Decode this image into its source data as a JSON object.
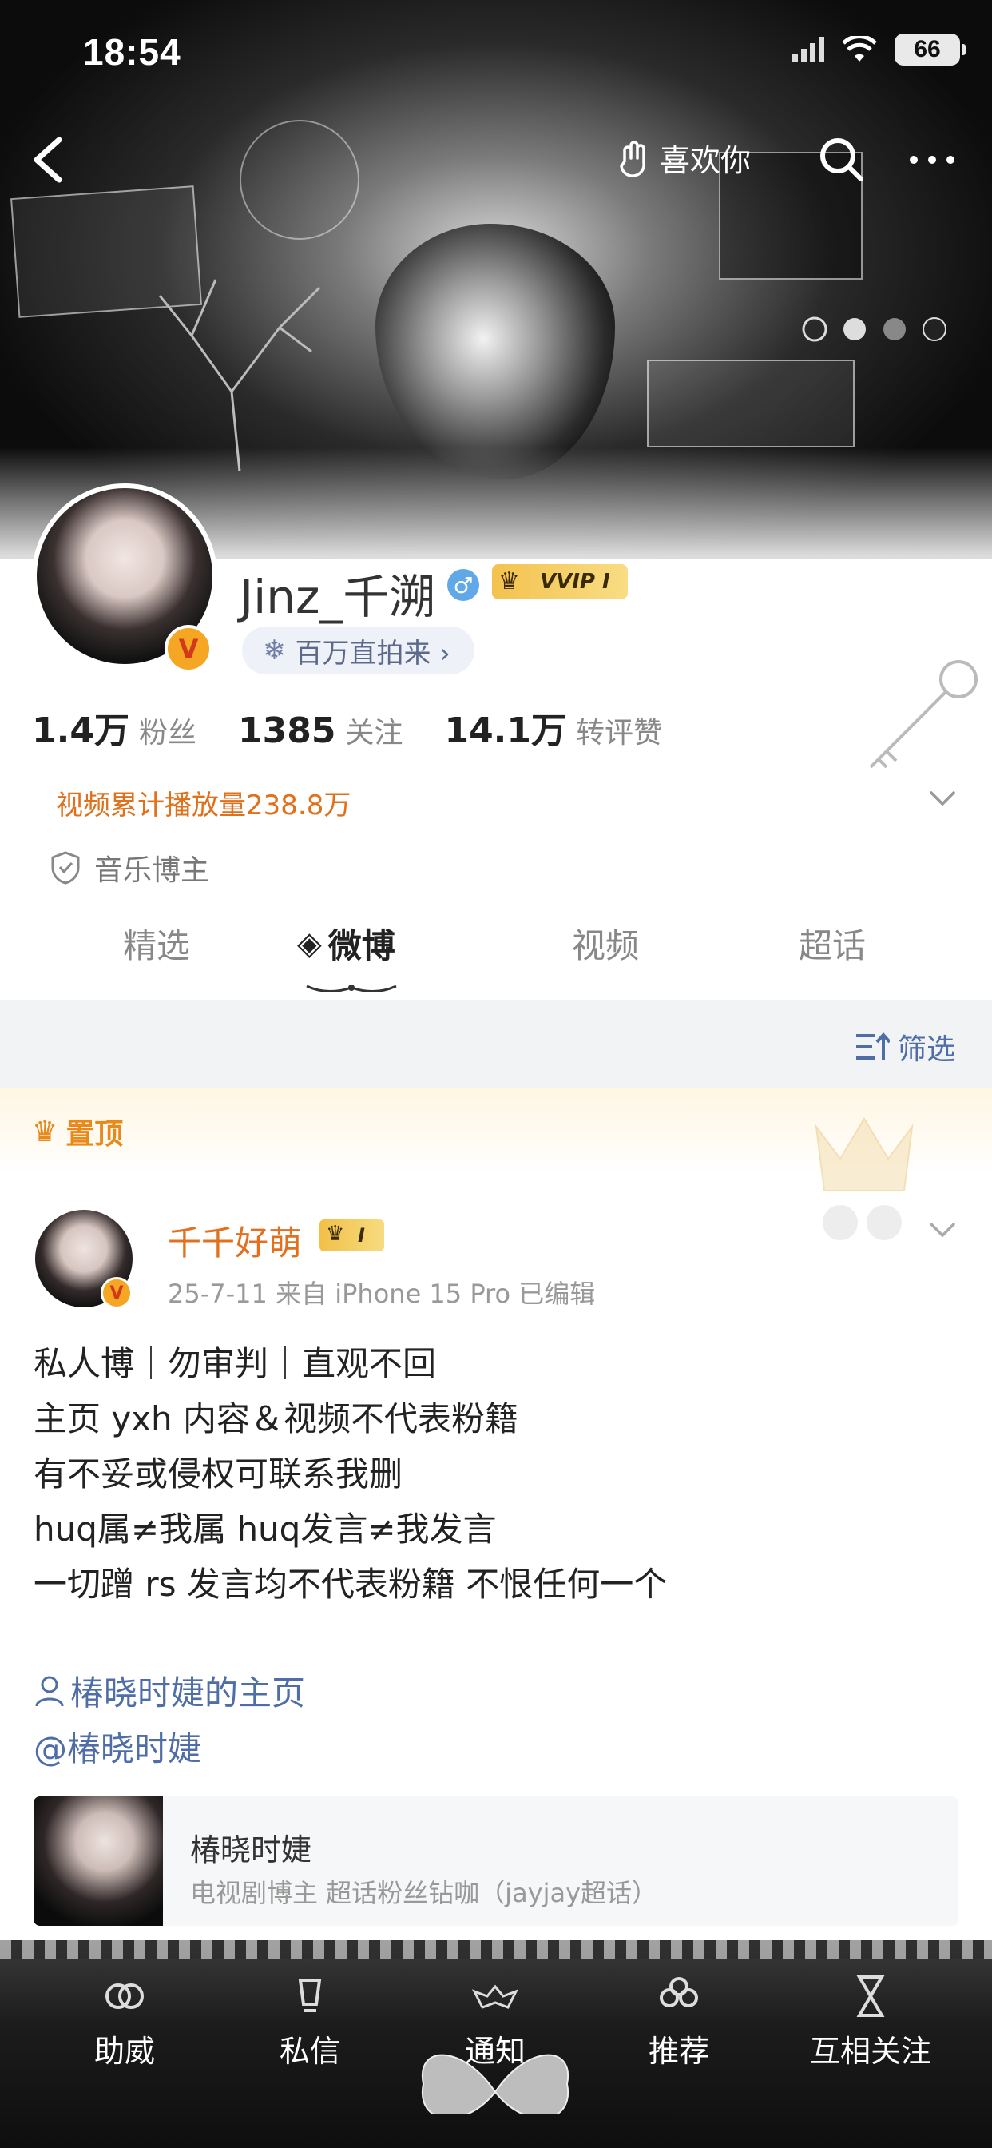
{
  "status_bar": {
    "time": "18:54",
    "battery": "66"
  },
  "nav": {
    "like_label": "喜欢你"
  },
  "profile": {
    "username": "Jinz_千溯",
    "vip_label": "VVIP I",
    "live_pill": "百万直拍来 ›",
    "stats": [
      {
        "value": "1.4万",
        "label": "粉丝"
      },
      {
        "value": "1385",
        "label": "关注"
      },
      {
        "value": "14.1万",
        "label": "转评赞"
      }
    ],
    "views_text": "视频累计播放量238.8万",
    "tag_text": "音乐博主"
  },
  "tabs": [
    "精选",
    "微博",
    "视频",
    "超话"
  ],
  "active_tab": "微博",
  "filter_label": "筛选",
  "pinned": {
    "label": "置顶",
    "author": "千千好萌",
    "vip_label": "I",
    "meta": "25-7-11  来自 iPhone 15 Pro  已编辑",
    "body_lines": [
      "私人博｜勿审判｜直观不回",
      "主页 yxh 内容＆视频不代表粉籍",
      "有不妥或侵权可联系我删",
      "huq属≠我属 huq发言≠我发言",
      "一切蹭 rs 发言均不代表粉籍 不恨任何一个"
    ],
    "home_link": "椿晓时婕的主页",
    "mention": "@椿晓时婕",
    "card_title": "椿晓时婕",
    "card_sub": "电视剧博主 超话粉丝钻咖（jayjay超话）"
  },
  "bottom_bar": [
    "助威",
    "私信",
    "通知",
    "推荐",
    "互相关注"
  ],
  "colors": {
    "accent_orange": "#e0701a",
    "link_blue": "#4f6ea8",
    "vip_gold": "#f3c24e"
  }
}
